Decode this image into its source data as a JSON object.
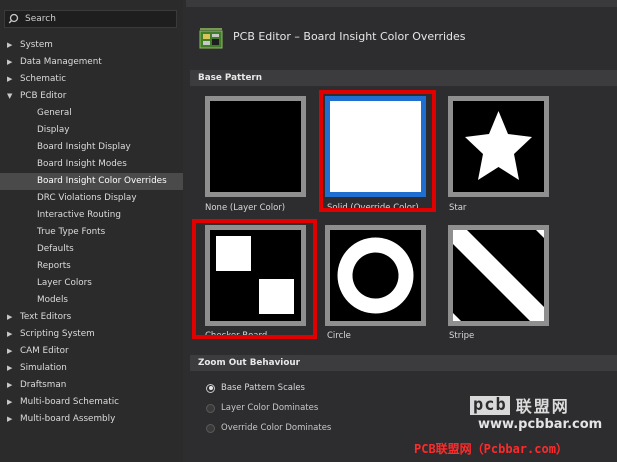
{
  "search": {
    "placeholder": "Search"
  },
  "tree": [
    {
      "label": "System",
      "arrow": "▶"
    },
    {
      "label": "Data Management",
      "arrow": "▶"
    },
    {
      "label": "Schematic",
      "arrow": "▶"
    },
    {
      "label": "PCB Editor",
      "arrow": "▼"
    },
    {
      "label": "General"
    },
    {
      "label": "Display"
    },
    {
      "label": "Board Insight Display"
    },
    {
      "label": "Board Insight Modes"
    },
    {
      "label": "Board Insight Color Overrides",
      "selected": true
    },
    {
      "label": "DRC Violations Display"
    },
    {
      "label": "Interactive Routing"
    },
    {
      "label": "True Type Fonts"
    },
    {
      "label": "Defaults"
    },
    {
      "label": "Reports"
    },
    {
      "label": "Layer Colors"
    },
    {
      "label": "Models"
    },
    {
      "label": "Text Editors",
      "arrow": "▶"
    },
    {
      "label": "Scripting System",
      "arrow": "▶"
    },
    {
      "label": "CAM Editor",
      "arrow": "▶"
    },
    {
      "label": "Simulation",
      "arrow": "▶"
    },
    {
      "label": "Draftsman",
      "arrow": "▶"
    },
    {
      "label": "Multi-board Schematic",
      "arrow": "▶"
    },
    {
      "label": "Multi-board Assembly",
      "arrow": "▶"
    }
  ],
  "header": {
    "title": "PCB Editor – Board Insight Color Overrides",
    "icon": "pcb-board-icon"
  },
  "base_pattern": {
    "title": "Base Pattern",
    "patterns": [
      {
        "label": "None (Layer Color)",
        "icon": "none-pattern"
      },
      {
        "label": "Solid (Override Color)",
        "icon": "solid-pattern",
        "selected": true
      },
      {
        "label": "Star",
        "icon": "star-pattern"
      },
      {
        "label": "Checker Board",
        "icon": "checker-pattern"
      },
      {
        "label": "Circle",
        "icon": "circle-pattern"
      },
      {
        "label": "Stripe",
        "icon": "stripe-pattern"
      }
    ]
  },
  "zoom_out": {
    "title": "Zoom Out Behaviour",
    "options": [
      {
        "label": "Base Pattern Scales",
        "checked": true
      },
      {
        "label": "Layer Color Dominates",
        "checked": false
      },
      {
        "label": "Override Color Dominates",
        "checked": false
      }
    ]
  },
  "watermark": {
    "logo": "pcb",
    "cn": "联盟网",
    "url": "www.pcbbar.com",
    "footer": "PCB联盟网（Pcbbar.com）"
  },
  "colors": {
    "highlight": "#e00000",
    "selected_border": "#1e6fd0"
  }
}
